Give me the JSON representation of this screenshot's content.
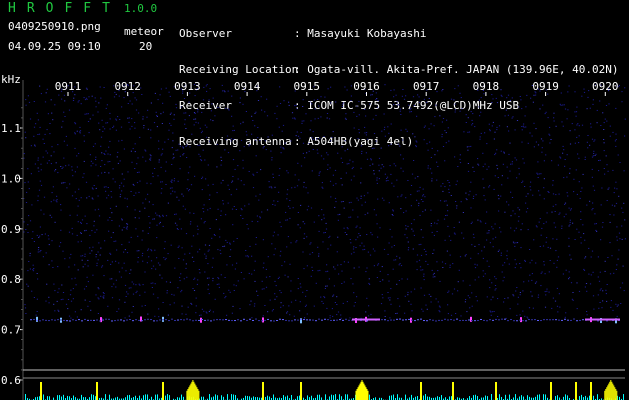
{
  "app": {
    "title": "HROFFT",
    "version": "1.0.0"
  },
  "file": {
    "name": "0409250910.png",
    "datetime": "04.09.25 09:10"
  },
  "meteor": {
    "label": "meteor",
    "count": "20"
  },
  "station": [
    {
      "label": "Observer",
      "value": ": Masayuki Kobayashi"
    },
    {
      "label": "Receiving Location",
      "value": ": Ogata-vill. Akita-Pref. JAPAN (139.96E, 40.02N)"
    },
    {
      "label": "Receiver",
      "value": ": ICOM IC-575 53.7492(@LCD)MHz USB"
    },
    {
      "label": "Receiving antenna",
      "value": ": A504HB(yagi 4el)"
    }
  ],
  "colors": {
    "title": "#20c840",
    "noise": "#1a1a8c",
    "echo": "#ff40ff",
    "bars": "#ffff00",
    "baseline": "#00ffff"
  },
  "chart_data": {
    "type": "heatmap",
    "ylabel": "kHz",
    "y_ticks": [
      "1.1",
      "1.0",
      "0.9",
      "0.8",
      "0.7",
      "0.6"
    ],
    "x_ticks": [
      "0911",
      "0912",
      "0913",
      "0914",
      "0915",
      "0916",
      "0917",
      "0918",
      "0919",
      "0920"
    ],
    "echo_frequency_khz": 0.72,
    "histogram_peaks": [
      "0913",
      "0916",
      "0920"
    ]
  }
}
